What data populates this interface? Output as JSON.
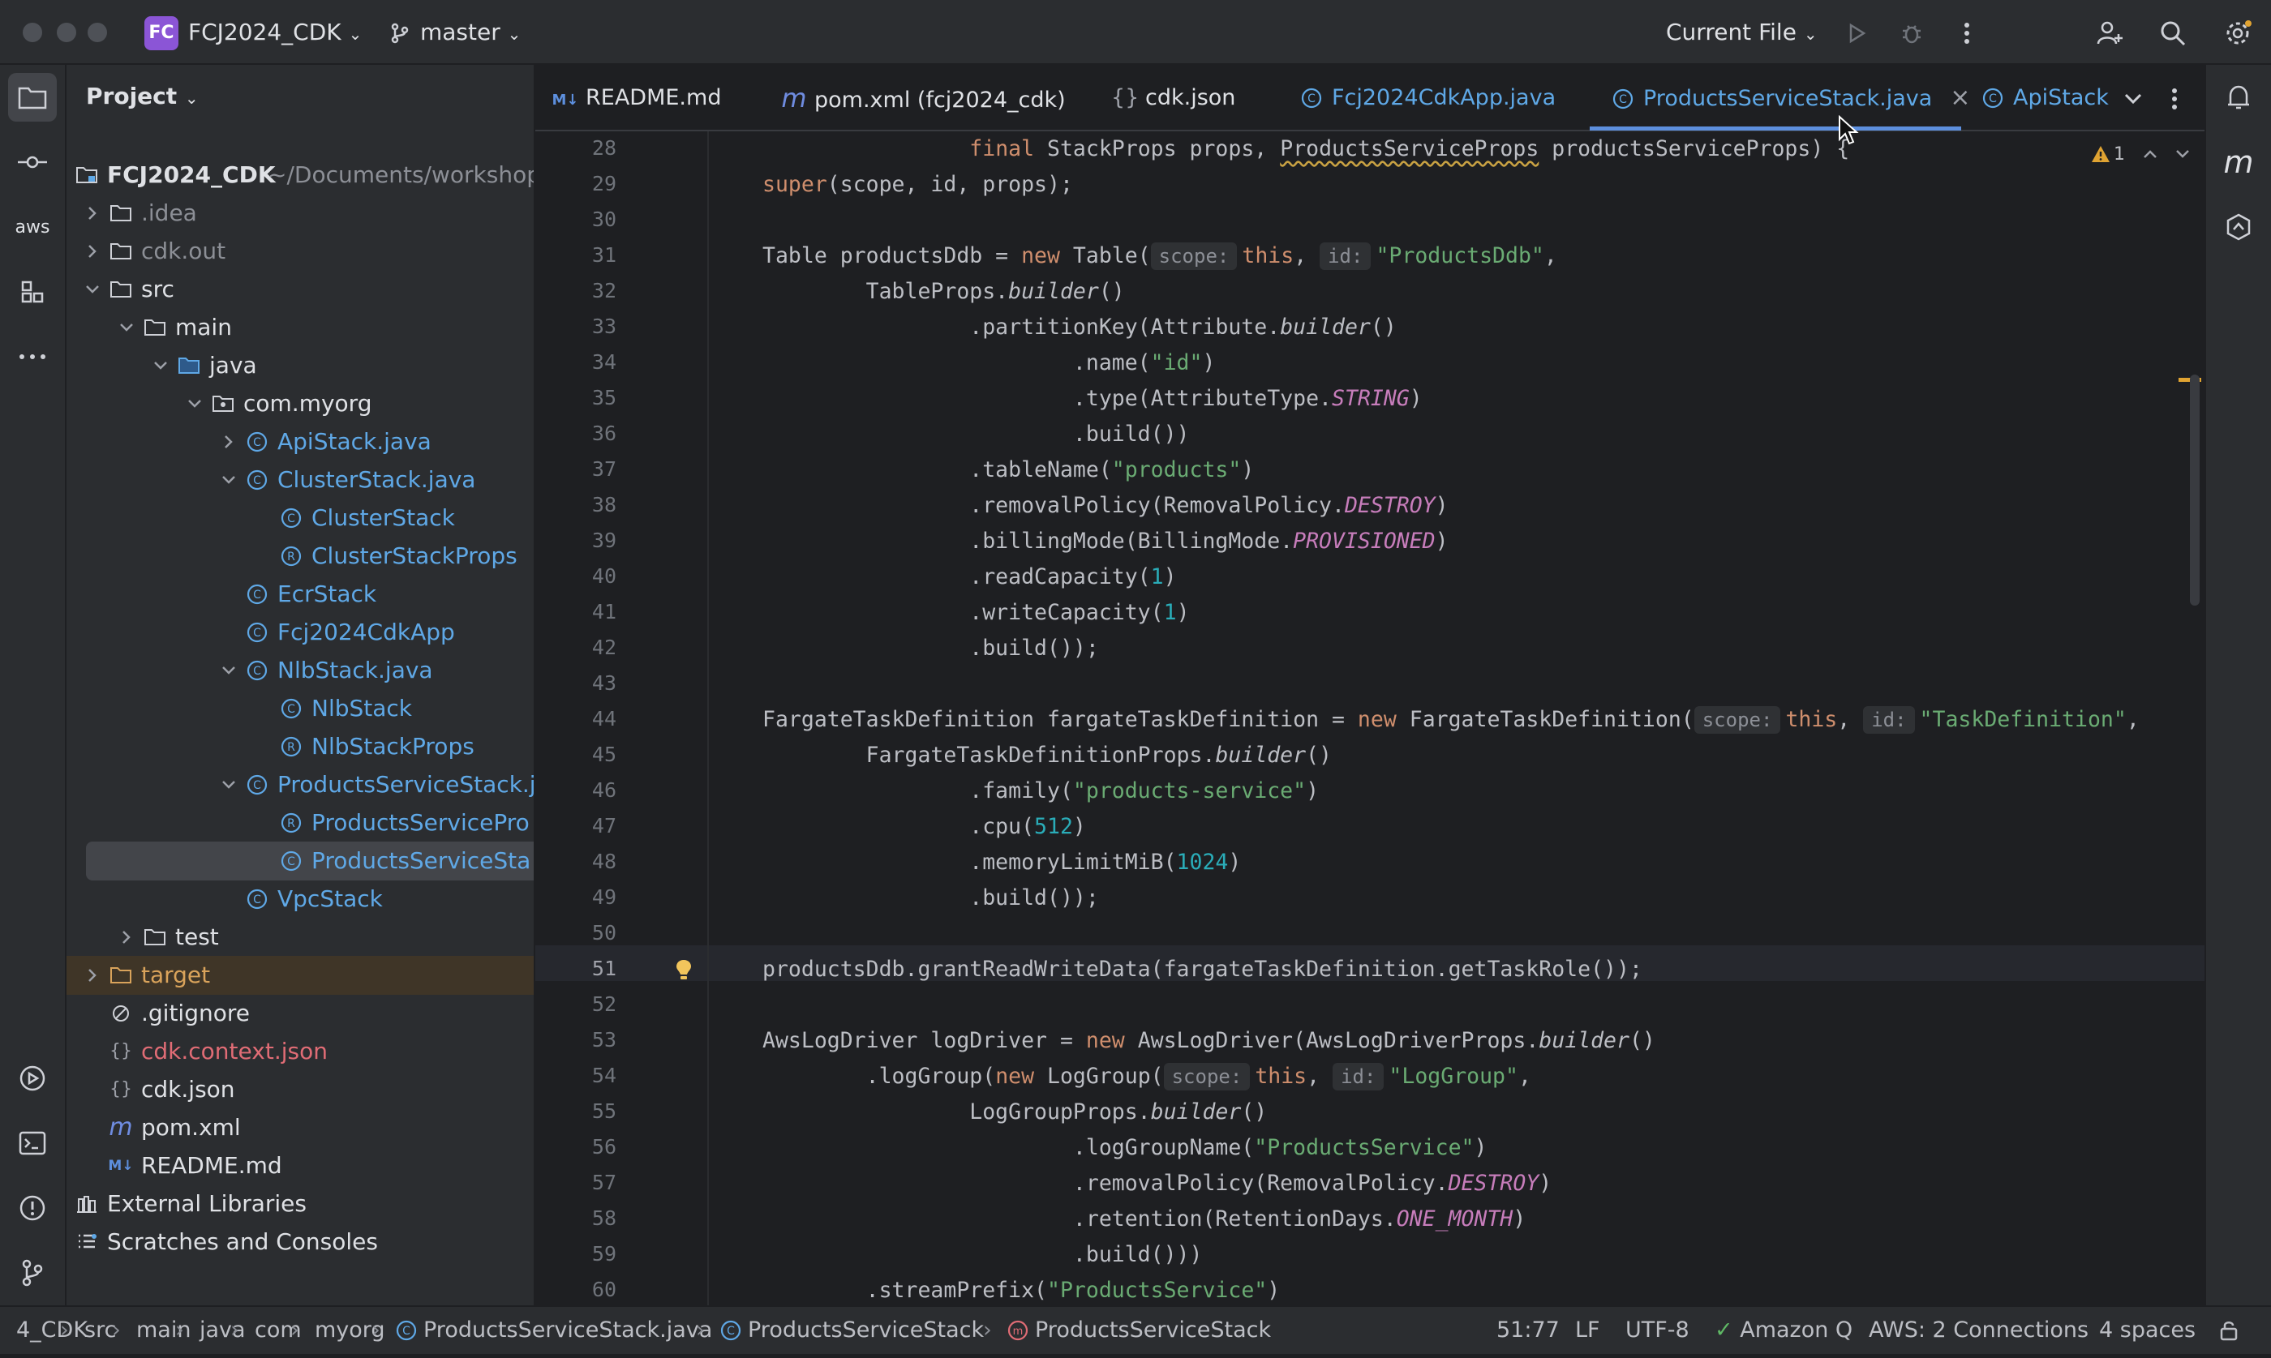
{
  "window": {
    "project_initials": "FC",
    "project_name": "FCJ2024_CDK",
    "branch": "master",
    "run_config": "Current File"
  },
  "project_panel": {
    "title": "Project",
    "tree": [
      {
        "label": "FCJ2024_CDK",
        "extra": "~/Documents/workshop",
        "icon": "module-folder-icon",
        "expanded": true,
        "bold": true
      },
      {
        "label": ".idea",
        "icon": "folder-icon",
        "expanded": false,
        "color": "#8c8f96"
      },
      {
        "label": "cdk.out",
        "icon": "folder-icon",
        "expanded": false,
        "color": "#8c8f96"
      },
      {
        "label": "src",
        "icon": "folder-icon",
        "expanded": true
      },
      {
        "label": "main",
        "icon": "folder-icon",
        "expanded": true
      },
      {
        "label": "java",
        "icon": "source-folder-icon",
        "expanded": true
      },
      {
        "label": "com.myorg",
        "icon": "package-icon",
        "expanded": true
      },
      {
        "label": "ApiStack.java",
        "icon": "class-icon",
        "expanded": false,
        "color": "#5fa8e6"
      },
      {
        "label": "ClusterStack.java",
        "icon": "class-icon",
        "expanded": true,
        "color": "#5fa8e6"
      },
      {
        "label": "ClusterStack",
        "icon": "class-icon",
        "color": "#5fa8e6"
      },
      {
        "label": "ClusterStackProps",
        "icon": "record-icon",
        "color": "#5fa8e6"
      },
      {
        "label": "EcrStack",
        "icon": "class-icon",
        "color": "#5fa8e6"
      },
      {
        "label": "Fcj2024CdkApp",
        "icon": "class-icon",
        "color": "#5fa8e6"
      },
      {
        "label": "NlbStack.java",
        "icon": "class-icon",
        "expanded": true,
        "color": "#5fa8e6"
      },
      {
        "label": "NlbStack",
        "icon": "class-icon",
        "color": "#5fa8e6"
      },
      {
        "label": "NlbStackProps",
        "icon": "record-icon",
        "color": "#5fa8e6"
      },
      {
        "label": "ProductsServiceStack.j",
        "icon": "class-icon",
        "expanded": true,
        "color": "#5fa8e6"
      },
      {
        "label": "ProductsServicePro",
        "icon": "record-icon",
        "color": "#5fa8e6"
      },
      {
        "label": "ProductsServiceSta",
        "icon": "class-icon",
        "color": "#5fa8e6",
        "selected": true
      },
      {
        "label": "VpcStack",
        "icon": "class-icon",
        "color": "#5fa8e6"
      },
      {
        "label": "test",
        "icon": "folder-icon",
        "expanded": false
      },
      {
        "label": "target",
        "icon": "excluded-folder-icon",
        "expanded": false,
        "color": "#d9a35b",
        "target": true
      },
      {
        "label": ".gitignore",
        "icon": "ignore-file-icon"
      },
      {
        "label": "cdk.context.json",
        "icon": "json-icon",
        "color": "#e06c75"
      },
      {
        "label": "cdk.json",
        "icon": "json-icon"
      },
      {
        "label": "pom.xml",
        "icon": "maven-icon"
      },
      {
        "label": "README.md",
        "icon": "markdown-icon"
      },
      {
        "label": "External Libraries",
        "icon": "library-icon",
        "expanded": false
      },
      {
        "label": "Scratches and Consoles",
        "icon": "scratches-icon",
        "expanded": false
      }
    ]
  },
  "tabs": [
    {
      "label": "README.md",
      "icon": "M↓",
      "icon_name": "markdown-icon",
      "color": "#5d8fde"
    },
    {
      "label": "pom.xml (fcj2024_cdk)",
      "icon": "m",
      "icon_name": "maven-icon",
      "color": "#6f8ce0"
    },
    {
      "label": "cdk.json",
      "icon": "{}",
      "icon_name": "json-icon",
      "color": "#9da0a8"
    },
    {
      "label": "Fcj2024CdkApp.java",
      "icon": "C",
      "icon_name": "class-icon",
      "color": "#5fa8e6"
    },
    {
      "label": "ProductsServiceStack.java",
      "icon": "C",
      "icon_name": "class-icon",
      "color": "#5fa8e6",
      "active": true
    },
    {
      "label": "ApiStack",
      "icon": "C",
      "icon_name": "class-icon",
      "color": "#5fa8e6"
    }
  ],
  "editor": {
    "warning_count": "1",
    "first_line": 28,
    "current_line": 51
  },
  "breadcrumb": [
    "4_CDK",
    "src",
    "main",
    "java",
    "com",
    "myorg",
    "ProductsServiceStack.java",
    "ProductsServiceStack",
    "ProductsServiceStack"
  ],
  "status": {
    "position": "51:77",
    "line_sep": "LF",
    "encoding": "UTF-8",
    "amazon_q": "Amazon Q",
    "aws": "AWS: 2 Connections",
    "indent": "4 spaces"
  },
  "strip": {
    "aws_label": "aws",
    "copilot_label": "m"
  }
}
